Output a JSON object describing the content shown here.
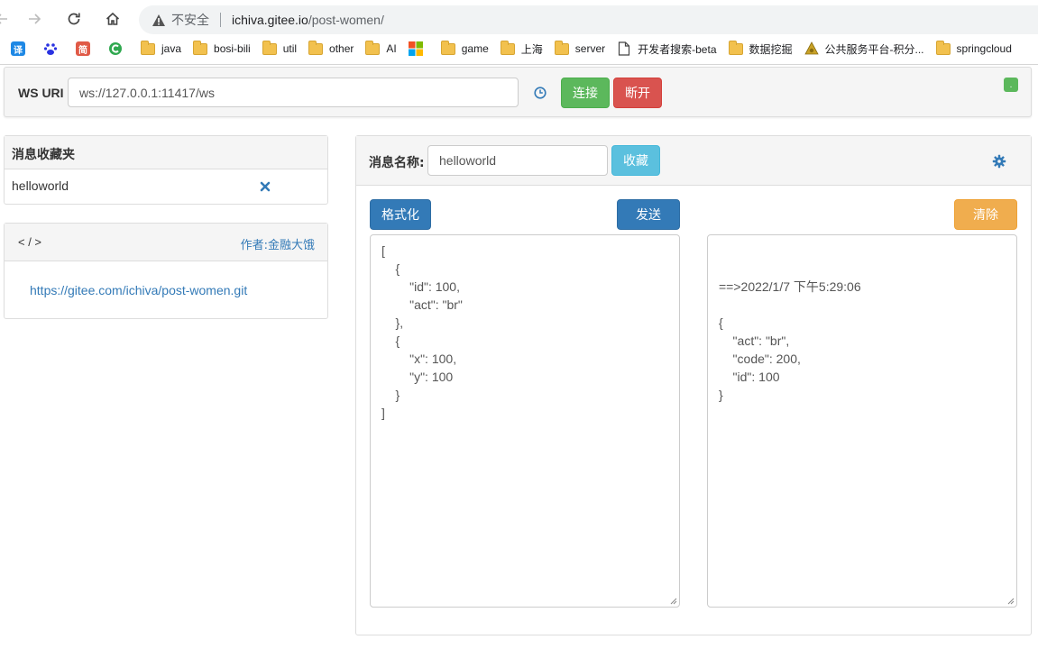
{
  "browser": {
    "insecure_label": "不安全",
    "url_host": "ichiva.gitee.io",
    "url_path": "/post-women/",
    "bookmarks": [
      {
        "icon": "translate-icon",
        "label": ""
      },
      {
        "icon": "baidu-icon",
        "label": ""
      },
      {
        "icon": "jian-icon",
        "label": ""
      },
      {
        "icon": "c-icon",
        "label": ""
      },
      {
        "icon": "folder-icon",
        "label": "java"
      },
      {
        "icon": "folder-icon",
        "label": "bosi-bili"
      },
      {
        "icon": "folder-icon",
        "label": "util"
      },
      {
        "icon": "folder-icon",
        "label": "other"
      },
      {
        "icon": "folder-icon",
        "label": "AI"
      },
      {
        "icon": "microsoft-icon",
        "label": ""
      },
      {
        "icon": "folder-icon",
        "label": "game"
      },
      {
        "icon": "folder-icon",
        "label": "上海"
      },
      {
        "icon": "folder-icon",
        "label": "server"
      },
      {
        "icon": "page-icon",
        "label": "开发者搜索-beta"
      },
      {
        "icon": "folder-icon",
        "label": "数据挖掘"
      },
      {
        "icon": "gov-icon",
        "label": "公共服务平台-积分..."
      },
      {
        "icon": "folder-icon",
        "label": "springcloud"
      }
    ]
  },
  "ws": {
    "label": "WS URI",
    "uri": "ws://127.0.0.1:11417/ws",
    "connect_label": "连接",
    "disconnect_label": "断开",
    "status": "."
  },
  "favorites": {
    "title": "消息收藏夹",
    "items": [
      {
        "label": "helloworld"
      }
    ]
  },
  "about": {
    "code": "< / >",
    "author": "作者:金融大饿",
    "link": "https://gitee.com/ichiva/post-women.git"
  },
  "main": {
    "msgname_label": "消息名称:",
    "msgname_value": "helloworld",
    "favorite_label": "收藏",
    "format_label": "格式化",
    "send_label": "发送",
    "clear_label": "清除",
    "request_text": "[\n    {\n        \"id\": 100,\n        \"act\": \"br\"\n    },\n    {\n        \"x\": 100,\n        \"y\": 100\n    }\n]",
    "response_text": "\n\n==>2022/1/7 下午5:29:06\n\n{\n    \"act\": \"br\",\n    \"code\": 200,\n    \"id\": 100\n}"
  },
  "colors": {
    "success": "#5cb85c",
    "danger": "#d9534f",
    "primary": "#337ab7",
    "info": "#5bc0de",
    "warning": "#f0ad4e"
  }
}
